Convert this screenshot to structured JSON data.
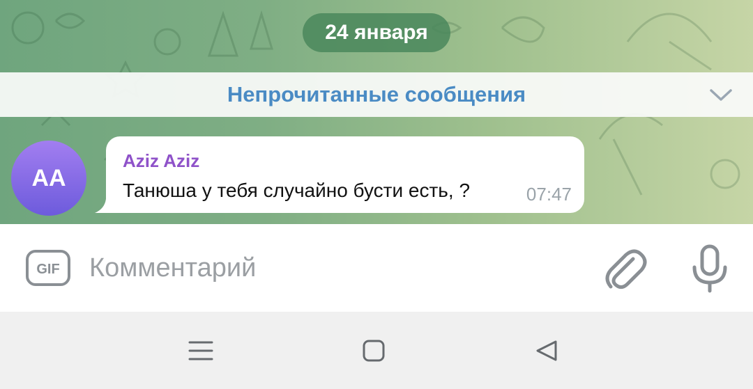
{
  "chat": {
    "date_separator": "24 января",
    "unread_label": "Непрочитанные сообщения",
    "unread_chevron_icon": "chevron-down-icon"
  },
  "message": {
    "avatar_initials": "AA",
    "sender_name": "Aziz Aziz",
    "text": "Танюша у тебя случайно бусти есть, ?",
    "time": "07:47"
  },
  "composer": {
    "gif_icon": "gif-icon",
    "placeholder": "Комментарий",
    "attach_icon": "paperclip-icon",
    "mic_icon": "microphone-icon"
  },
  "navbar": {
    "menu_icon": "menu-icon",
    "home_icon": "home-square-icon",
    "back_icon": "back-triangle-icon"
  },
  "colors": {
    "accent_blue": "#4a8bc4",
    "sender_purple": "#8f52c9",
    "date_pill_green": "#4a875c",
    "avatar_gradient_top": "#a27ef0",
    "avatar_gradient_bottom": "#6d5bdc"
  }
}
